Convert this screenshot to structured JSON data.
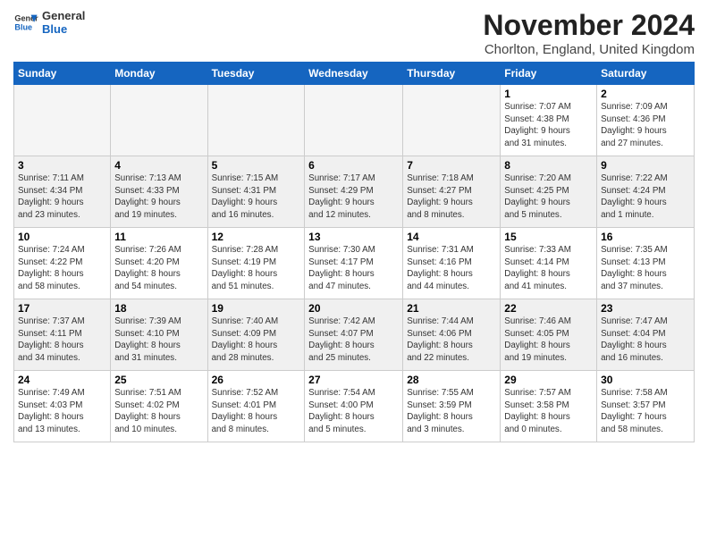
{
  "header": {
    "logo_line1": "General",
    "logo_line2": "Blue",
    "month": "November 2024",
    "location": "Chorlton, England, United Kingdom"
  },
  "days_of_week": [
    "Sunday",
    "Monday",
    "Tuesday",
    "Wednesday",
    "Thursday",
    "Friday",
    "Saturday"
  ],
  "weeks": [
    [
      {
        "day": "",
        "info": ""
      },
      {
        "day": "",
        "info": ""
      },
      {
        "day": "",
        "info": ""
      },
      {
        "day": "",
        "info": ""
      },
      {
        "day": "",
        "info": ""
      },
      {
        "day": "1",
        "info": "Sunrise: 7:07 AM\nSunset: 4:38 PM\nDaylight: 9 hours\nand 31 minutes."
      },
      {
        "day": "2",
        "info": "Sunrise: 7:09 AM\nSunset: 4:36 PM\nDaylight: 9 hours\nand 27 minutes."
      }
    ],
    [
      {
        "day": "3",
        "info": "Sunrise: 7:11 AM\nSunset: 4:34 PM\nDaylight: 9 hours\nand 23 minutes."
      },
      {
        "day": "4",
        "info": "Sunrise: 7:13 AM\nSunset: 4:33 PM\nDaylight: 9 hours\nand 19 minutes."
      },
      {
        "day": "5",
        "info": "Sunrise: 7:15 AM\nSunset: 4:31 PM\nDaylight: 9 hours\nand 16 minutes."
      },
      {
        "day": "6",
        "info": "Sunrise: 7:17 AM\nSunset: 4:29 PM\nDaylight: 9 hours\nand 12 minutes."
      },
      {
        "day": "7",
        "info": "Sunrise: 7:18 AM\nSunset: 4:27 PM\nDaylight: 9 hours\nand 8 minutes."
      },
      {
        "day": "8",
        "info": "Sunrise: 7:20 AM\nSunset: 4:25 PM\nDaylight: 9 hours\nand 5 minutes."
      },
      {
        "day": "9",
        "info": "Sunrise: 7:22 AM\nSunset: 4:24 PM\nDaylight: 9 hours\nand 1 minute."
      }
    ],
    [
      {
        "day": "10",
        "info": "Sunrise: 7:24 AM\nSunset: 4:22 PM\nDaylight: 8 hours\nand 58 minutes."
      },
      {
        "day": "11",
        "info": "Sunrise: 7:26 AM\nSunset: 4:20 PM\nDaylight: 8 hours\nand 54 minutes."
      },
      {
        "day": "12",
        "info": "Sunrise: 7:28 AM\nSunset: 4:19 PM\nDaylight: 8 hours\nand 51 minutes."
      },
      {
        "day": "13",
        "info": "Sunrise: 7:30 AM\nSunset: 4:17 PM\nDaylight: 8 hours\nand 47 minutes."
      },
      {
        "day": "14",
        "info": "Sunrise: 7:31 AM\nSunset: 4:16 PM\nDaylight: 8 hours\nand 44 minutes."
      },
      {
        "day": "15",
        "info": "Sunrise: 7:33 AM\nSunset: 4:14 PM\nDaylight: 8 hours\nand 41 minutes."
      },
      {
        "day": "16",
        "info": "Sunrise: 7:35 AM\nSunset: 4:13 PM\nDaylight: 8 hours\nand 37 minutes."
      }
    ],
    [
      {
        "day": "17",
        "info": "Sunrise: 7:37 AM\nSunset: 4:11 PM\nDaylight: 8 hours\nand 34 minutes."
      },
      {
        "day": "18",
        "info": "Sunrise: 7:39 AM\nSunset: 4:10 PM\nDaylight: 8 hours\nand 31 minutes."
      },
      {
        "day": "19",
        "info": "Sunrise: 7:40 AM\nSunset: 4:09 PM\nDaylight: 8 hours\nand 28 minutes."
      },
      {
        "day": "20",
        "info": "Sunrise: 7:42 AM\nSunset: 4:07 PM\nDaylight: 8 hours\nand 25 minutes."
      },
      {
        "day": "21",
        "info": "Sunrise: 7:44 AM\nSunset: 4:06 PM\nDaylight: 8 hours\nand 22 minutes."
      },
      {
        "day": "22",
        "info": "Sunrise: 7:46 AM\nSunset: 4:05 PM\nDaylight: 8 hours\nand 19 minutes."
      },
      {
        "day": "23",
        "info": "Sunrise: 7:47 AM\nSunset: 4:04 PM\nDaylight: 8 hours\nand 16 minutes."
      }
    ],
    [
      {
        "day": "24",
        "info": "Sunrise: 7:49 AM\nSunset: 4:03 PM\nDaylight: 8 hours\nand 13 minutes."
      },
      {
        "day": "25",
        "info": "Sunrise: 7:51 AM\nSunset: 4:02 PM\nDaylight: 8 hours\nand 10 minutes."
      },
      {
        "day": "26",
        "info": "Sunrise: 7:52 AM\nSunset: 4:01 PM\nDaylight: 8 hours\nand 8 minutes."
      },
      {
        "day": "27",
        "info": "Sunrise: 7:54 AM\nSunset: 4:00 PM\nDaylight: 8 hours\nand 5 minutes."
      },
      {
        "day": "28",
        "info": "Sunrise: 7:55 AM\nSunset: 3:59 PM\nDaylight: 8 hours\nand 3 minutes."
      },
      {
        "day": "29",
        "info": "Sunrise: 7:57 AM\nSunset: 3:58 PM\nDaylight: 8 hours\nand 0 minutes."
      },
      {
        "day": "30",
        "info": "Sunrise: 7:58 AM\nSunset: 3:57 PM\nDaylight: 7 hours\nand 58 minutes."
      }
    ]
  ]
}
